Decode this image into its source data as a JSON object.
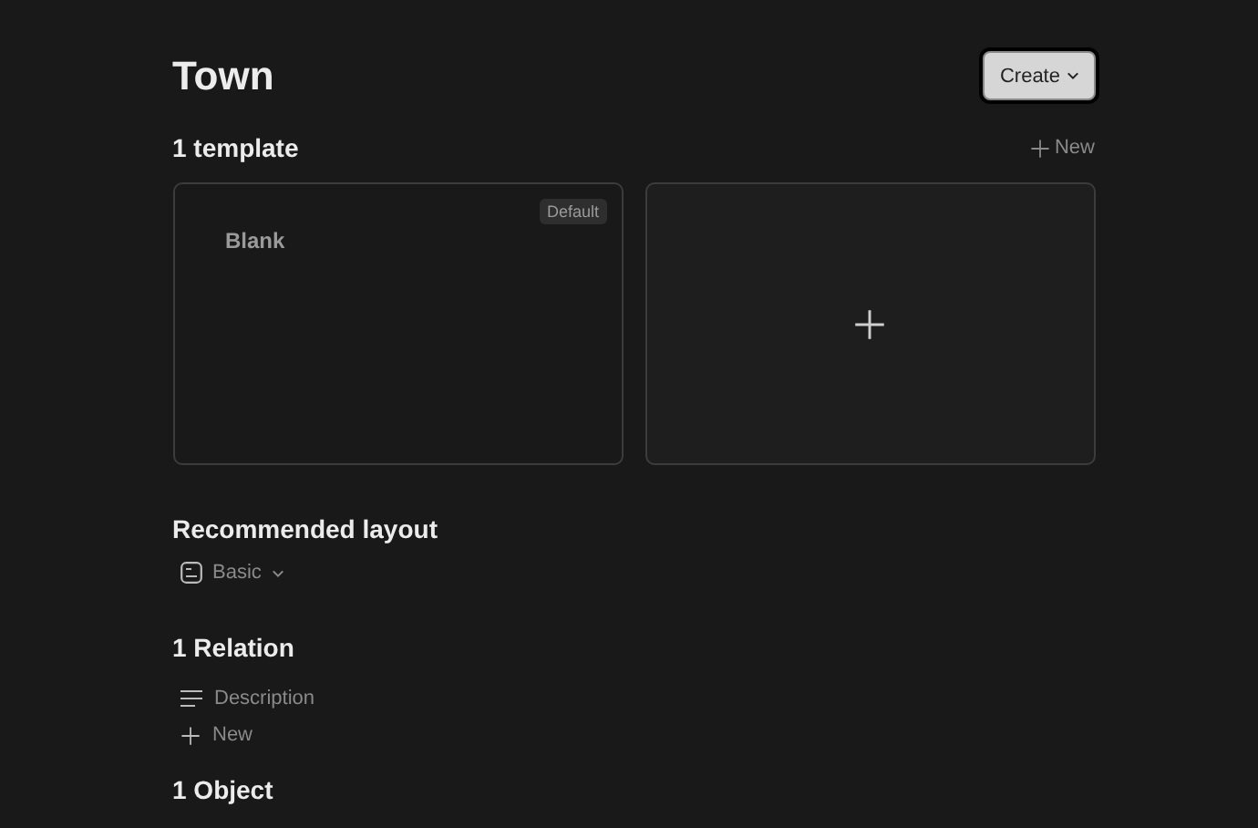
{
  "title": "Town",
  "create_button": {
    "label": "Create"
  },
  "templates": {
    "heading": "1 template",
    "new_label": "New",
    "cards": [
      {
        "kind": "template",
        "name": "Blank",
        "badge": "Default"
      },
      {
        "kind": "add"
      }
    ]
  },
  "layout": {
    "heading": "Recommended layout",
    "value": "Basic"
  },
  "relations": {
    "heading": "1 Relation",
    "items": [
      {
        "kind": "text",
        "label": "Description"
      },
      {
        "kind": "add",
        "label": "New"
      }
    ]
  },
  "objects": {
    "heading": "1 Object"
  }
}
